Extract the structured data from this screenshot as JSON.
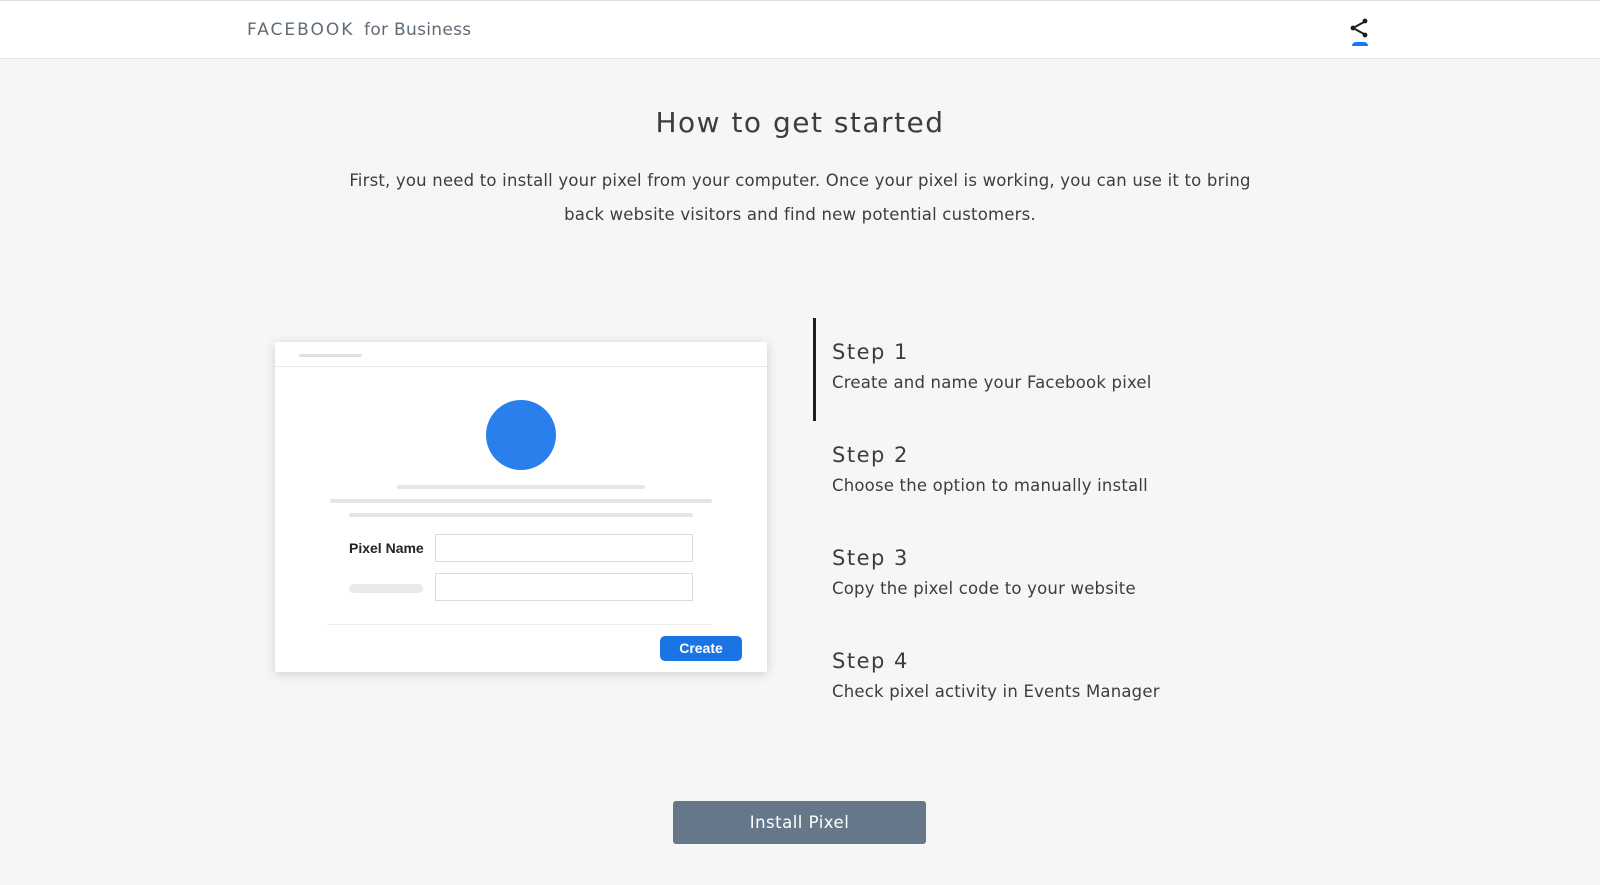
{
  "header": {
    "brand_main": "FACEBOOK",
    "brand_sub": "for Business",
    "share_icon": "share-icon"
  },
  "intro": {
    "title": "How to get started",
    "description": "First, you need to install your pixel from your computer. Once your pixel is working, you can use it to bring back website visitors and find new potential customers."
  },
  "illustration": {
    "pixel_name_label": "Pixel Name",
    "create_label": "Create"
  },
  "steps": [
    {
      "title": "Step 1",
      "description": "Create and name your Facebook pixel",
      "active": true
    },
    {
      "title": "Step 2",
      "description": "Choose the option to manually install",
      "active": false
    },
    {
      "title": "Step 3",
      "description": "Copy the pixel code to your website",
      "active": false
    },
    {
      "title": "Step 4",
      "description": "Check pixel activity in Events Manager",
      "active": false
    }
  ],
  "actions": {
    "install_label": "Install Pixel"
  },
  "colors": {
    "accent": "#1877f2",
    "button": "#667789",
    "background": "#f5f6f6"
  }
}
